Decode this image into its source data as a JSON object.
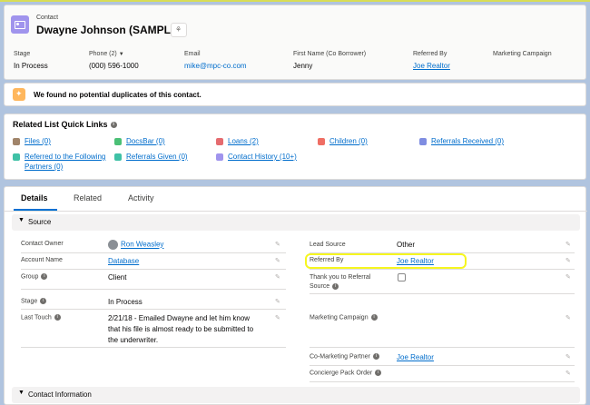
{
  "header": {
    "record_type": "Contact",
    "name": "Dwayne Johnson (SAMPLE)",
    "icon": "contact-card-icon",
    "fields": [
      {
        "label": "Stage",
        "value": "In Process"
      },
      {
        "label": "Phone (2)",
        "value": "(000) 596-1000"
      },
      {
        "label": "Email",
        "value": "mike@mpc-co.com"
      },
      {
        "label": "First Name (Co Borrower)",
        "value": "Jenny"
      },
      {
        "label": "Referred By",
        "value": "Joe Realtor"
      },
      {
        "label": "Marketing Campaign",
        "value": ""
      }
    ]
  },
  "duplicates": {
    "message": "We found no potential duplicates of this contact."
  },
  "quick_links": {
    "title": "Related List Quick Links",
    "items": [
      {
        "label": "Files (0)",
        "color": "#a0846a"
      },
      {
        "label": "DocsBar (0)",
        "color": "#4bc076"
      },
      {
        "label": "Loans (2)",
        "color": "#e56b6f"
      },
      {
        "label": "Children (0)",
        "color": "#ef6e64"
      },
      {
        "label": "Referrals Received (0)",
        "color": "#7f8de1"
      },
      {
        "label": "Referred to the Following",
        "label2": "Partners (0)",
        "color": "#3fc1a6"
      },
      {
        "label": "Referrals Given (0)",
        "color": "#3fc1a6"
      },
      {
        "label": "Contact History (10+)",
        "color": "#a094ed"
      }
    ]
  },
  "tabs": [
    "Details",
    "Related",
    "Activity"
  ],
  "source_section": {
    "title": "Source",
    "left": [
      {
        "label": "Contact Owner",
        "value": "Ron Weasley"
      },
      {
        "label": "Account Name",
        "value": "Database"
      },
      {
        "label": "Group",
        "value": "Client"
      },
      {
        "label": "Stage",
        "value": "In Process"
      },
      {
        "label": "Last Touch",
        "value": "2/21/18 - Emailed Dwayne and let him know",
        "value2": "that his file is almost ready to be submitted to",
        "value3": "the underwriter."
      }
    ],
    "right": [
      {
        "label": "Lead Source",
        "value": "Other"
      },
      {
        "label": "Referred By",
        "value": "Joe Realtor"
      },
      {
        "label": "Thank you to Referral",
        "label2": "Source",
        "value": ""
      },
      {
        "label": "Marketing Campaign",
        "value": ""
      },
      {
        "label": "Co-Marketing Partner",
        "value": "Joe Realtor"
      },
      {
        "label": "Concierge Pack Order",
        "value": ""
      }
    ]
  },
  "contact_section": {
    "title": "Contact Information"
  }
}
